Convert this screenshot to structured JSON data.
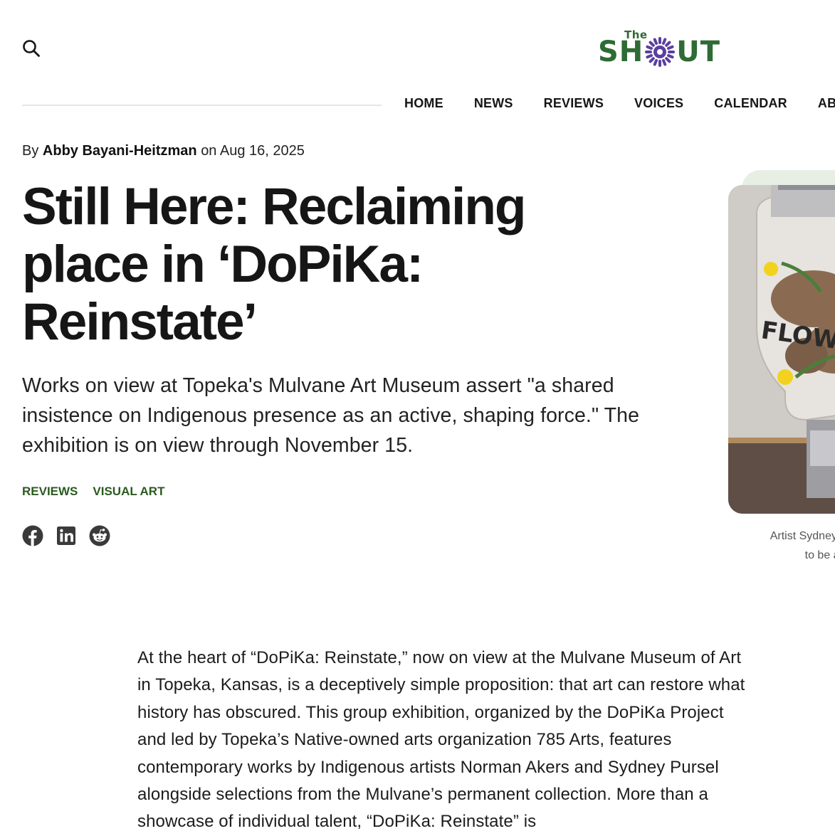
{
  "header": {
    "search_icon": "search-icon",
    "logo_small": "The",
    "logo_left": "SH",
    "logo_right": "UT",
    "logo_color": "#2f6b35",
    "logo_sun_color": "#5b3fa0"
  },
  "nav": {
    "items": [
      "HOME",
      "NEWS",
      "REVIEWS",
      "VOICES",
      "CALENDAR",
      "ABOUT"
    ]
  },
  "article": {
    "byline_prefix": "By",
    "author": "Abby Bayani-Heitzman",
    "date_prefix": "on",
    "date": "Aug 16, 2025",
    "title": "Still Here: Reclaiming place in ‘DoPiKa: Reinstate’",
    "dek": "Works on view at Topeka's Mulvane Art Museum assert \"a shared insistence on Indigenous presence as an active, shaping force.\" The exhibition is on view through November 15.",
    "tags": [
      "REVIEWS",
      "VISUAL ART"
    ],
    "share_icons": [
      "facebook-icon",
      "linkedin-icon",
      "reddit-icon"
    ],
    "image_caption_line1": "Artist Sydney Pu",
    "image_caption_line2": "to be acts",
    "body": "At the heart of “DoPiKa: Reinstate,” now on view at the Mulvane Museum of Art in Topeka, Kansas, is a deceptively simple proposition: that art can restore what history has obscured. This group exhibition, organized by the DoPiKa Project and led by Topeka’s Native-owned arts organization 785 Arts, features contemporary works by Indigenous artists Norman Akers and Sydney Pursel alongside selections from the Mulvane’s permanent collection. More than a showcase of individual talent, “DoPiKa: Reinstate” is"
  },
  "colors": {
    "tag_green": "#2a5a1f",
    "backdrop_green": "#e7efe5",
    "text": "#161616"
  }
}
